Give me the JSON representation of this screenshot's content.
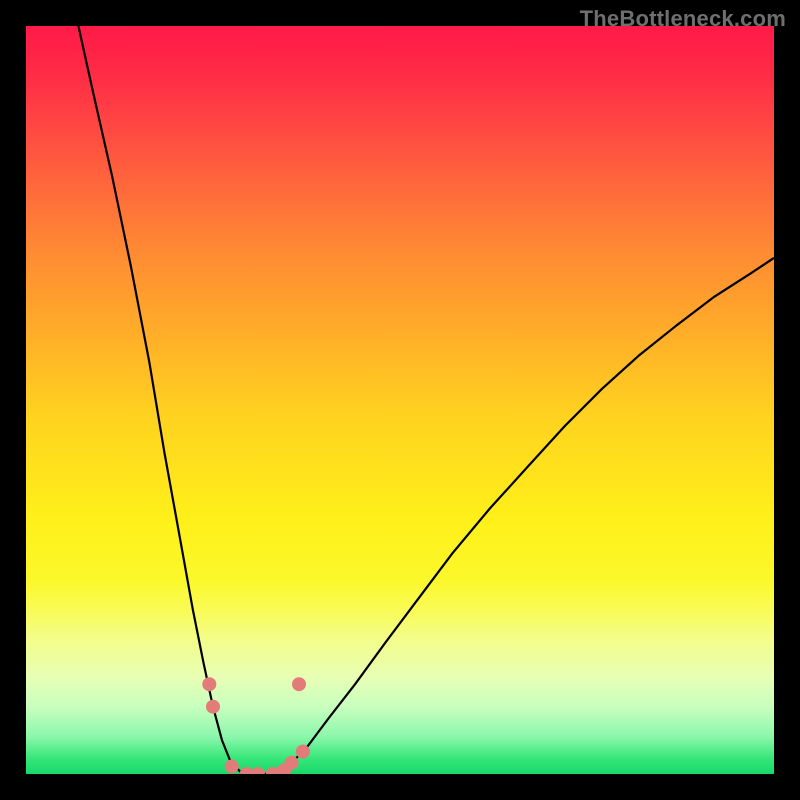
{
  "watermark": "TheBottleneck.com",
  "chart_data": {
    "type": "line",
    "title": "",
    "xlabel": "",
    "ylabel": "",
    "xlim": [
      0,
      100
    ],
    "ylim": [
      0,
      100
    ],
    "grid": false,
    "legend": false,
    "description": "A V-shaped black curve plotted over a vertical rainbow heat gradient (red at top through yellow to green at bottom). The curve descends steeply from the top-left, reaches a flat minimum near the bottom around x≈30, and rises more gently toward the upper-right. Several salmon-colored marker points sit near the minimum.",
    "curve": [
      {
        "x": 7.0,
        "y": 100.0
      },
      {
        "x": 9.0,
        "y": 91.0
      },
      {
        "x": 11.5,
        "y": 80.0
      },
      {
        "x": 14.0,
        "y": 68.0
      },
      {
        "x": 16.5,
        "y": 55.0
      },
      {
        "x": 18.5,
        "y": 43.0
      },
      {
        "x": 20.5,
        "y": 32.0
      },
      {
        "x": 22.3,
        "y": 22.0
      },
      {
        "x": 23.7,
        "y": 15.0
      },
      {
        "x": 25.0,
        "y": 9.0
      },
      {
        "x": 26.2,
        "y": 4.5
      },
      {
        "x": 27.4,
        "y": 1.5
      },
      {
        "x": 29.0,
        "y": 0.0
      },
      {
        "x": 31.0,
        "y": 0.0
      },
      {
        "x": 33.0,
        "y": 0.0
      },
      {
        "x": 35.0,
        "y": 1.0
      },
      {
        "x": 37.5,
        "y": 3.5
      },
      {
        "x": 40.5,
        "y": 7.5
      },
      {
        "x": 44.0,
        "y": 12.0
      },
      {
        "x": 48.0,
        "y": 17.5
      },
      {
        "x": 52.5,
        "y": 23.5
      },
      {
        "x": 57.0,
        "y": 29.5
      },
      {
        "x": 62.0,
        "y": 35.5
      },
      {
        "x": 67.0,
        "y": 41.0
      },
      {
        "x": 72.0,
        "y": 46.5
      },
      {
        "x": 77.0,
        "y": 51.5
      },
      {
        "x": 82.0,
        "y": 56.0
      },
      {
        "x": 87.0,
        "y": 60.0
      },
      {
        "x": 92.0,
        "y": 63.8
      },
      {
        "x": 97.0,
        "y": 67.0
      },
      {
        "x": 100.0,
        "y": 69.0
      }
    ],
    "markers": [
      {
        "x": 24.5,
        "y": 12.0
      },
      {
        "x": 25.0,
        "y": 9.0
      },
      {
        "x": 27.5,
        "y": 1.0
      },
      {
        "x": 29.5,
        "y": 0.0
      },
      {
        "x": 31.0,
        "y": 0.0
      },
      {
        "x": 33.0,
        "y": 0.0
      },
      {
        "x": 34.5,
        "y": 0.5
      },
      {
        "x": 35.5,
        "y": 1.5
      },
      {
        "x": 37.0,
        "y": 3.0
      },
      {
        "x": 36.5,
        "y": 12.0
      }
    ],
    "marker_radius_px": 7
  }
}
